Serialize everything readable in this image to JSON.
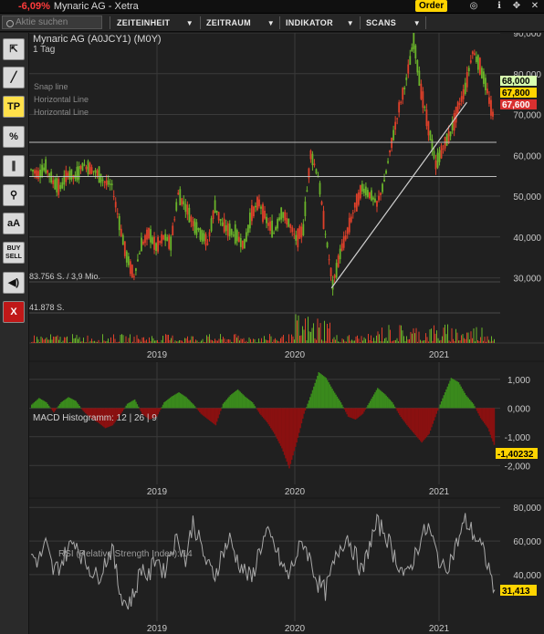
{
  "titlebar": {
    "change": "-6,09%",
    "title": "Mynaric AG - Xetra",
    "order_label": "Order"
  },
  "menubar": {
    "search_placeholder": "Aktie suchen",
    "items": [
      {
        "label": "ZEITEINHEIT"
      },
      {
        "label": "ZEITRAUM"
      },
      {
        "label": "INDIKATOR"
      },
      {
        "label": "SCANS"
      }
    ]
  },
  "toolbar": {
    "tools": [
      {
        "name": "cursor-tool",
        "label": "⇱"
      },
      {
        "name": "line-tool",
        "label": "╱"
      },
      {
        "name": "tp-tool",
        "label": "TP"
      },
      {
        "name": "percent-tool",
        "label": "%"
      },
      {
        "name": "parallel-tool",
        "label": "∥"
      },
      {
        "name": "zoom-tool",
        "label": "⚲"
      },
      {
        "name": "text-tool",
        "label": "aA"
      },
      {
        "name": "buy-sell-tool",
        "label": "BUY SELL"
      },
      {
        "name": "sound-tool",
        "label": "◀)"
      },
      {
        "name": "delete-tool",
        "label": "X"
      }
    ]
  },
  "colors": {
    "up": "#6ab42a",
    "down": "#e0402a",
    "macd_pos": "#3a8a1c",
    "macd_neg": "#8a1010",
    "grid": "#3a3a3a",
    "price_now": "#ffd400",
    "ask": "#d8ffb0",
    "bid": "#ff5050"
  },
  "main_chart": {
    "title": "Mynaric AG (A0JCY1) (M0Y)",
    "interval": "1 Tag",
    "annotations": [
      "Snap line",
      "Horizontal Line",
      "Horizontal Line"
    ],
    "volume_label_1": "83.756 S. / 3,9 Mio.",
    "volume_label_2": "41.878 S.",
    "price_tags": {
      "top": "68,000",
      "mid": "67,800",
      "bottom": "67,600"
    }
  },
  "macd_pane": {
    "label": "MACD Histogramm: 12 | 26 | 9",
    "value_tag": "-1,40232"
  },
  "rsi_pane": {
    "label": "RSI (Relative Strength Index): 14",
    "value_tag": "31,413"
  },
  "chart_data": [
    {
      "type": "line",
      "title": "Mynaric AG (A0JCY1) (M0Y)",
      "xlabel": "",
      "ylabel": "",
      "x_ticks": [
        "2019",
        "2020",
        "2021"
      ],
      "y_ticks": [
        30000,
        40000,
        50000,
        60000,
        70000,
        80000,
        90000
      ],
      "y_tick_labels": [
        "30,000",
        "40,000",
        "50,000",
        "60,000",
        "70,000",
        "80,000",
        "90,000"
      ],
      "ylim": [
        27000,
        90000
      ],
      "series": [
        {
          "values": [
            56500,
            55500,
            57000,
            53500,
            52000,
            55500,
            54500,
            57500,
            57000,
            55500,
            53500,
            52500,
            43500,
            35000,
            30500,
            38000,
            41000,
            37500,
            40000,
            38500,
            50500,
            47500,
            43500,
            41000,
            38500,
            47500,
            43000,
            41500,
            40000,
            38000,
            46000,
            48500,
            44000,
            41000,
            46000,
            43500,
            39500,
            42000,
            60500,
            55000,
            41000,
            28000,
            36000,
            41500,
            47500,
            52000,
            50500,
            48000,
            53500,
            63000,
            71500,
            78500,
            88000,
            76000,
            67000,
            57500,
            62000,
            65500,
            71500,
            76500,
            85500,
            82000,
            75500,
            68000
          ]
        }
      ],
      "horizontal_lines": [
        63200,
        54800
      ],
      "trend_line": {
        "from": [
          0.648,
          27500
        ],
        "to": [
          0.94,
          73000
        ]
      }
    },
    {
      "type": "bar",
      "title": "MACD Histogramm: 12 | 26 | 9",
      "y_ticks": [
        -2000,
        -1000,
        0,
        1000
      ],
      "y_tick_labels": [
        "-2,000",
        "-1,000",
        "0,000",
        "1,000"
      ],
      "ylim": [
        -2500,
        1600
      ],
      "values": [
        120,
        350,
        200,
        -150,
        200,
        380,
        250,
        -100,
        -350,
        -500,
        -700,
        -600,
        -250,
        150,
        300,
        -200,
        -400,
        -300,
        200,
        400,
        550,
        380,
        120,
        -200,
        -400,
        -600,
        150,
        450,
        650,
        400,
        200,
        -200,
        -500,
        -900,
        -1400,
        -2100,
        -1200,
        -200,
        500,
        1250,
        1050,
        600,
        200,
        -300,
        -400,
        -200,
        250,
        700,
        480,
        200,
        -250,
        -600,
        -900,
        -1200,
        -900,
        -200,
        450,
        1050,
        900,
        450,
        150,
        -350,
        -700,
        -1400
      ]
    },
    {
      "type": "line",
      "title": "RSI (Relative Strength Index): 14",
      "y_ticks": [
        40,
        60,
        80
      ],
      "y_tick_labels": [
        "40,000",
        "60,000",
        "80,000"
      ],
      "ylim": [
        15,
        85
      ],
      "series": [
        {
          "values": [
            52,
            48,
            58,
            42,
            46,
            55,
            61,
            50,
            44,
            38,
            47,
            56,
            31,
            22,
            28,
            45,
            38,
            52,
            41,
            55,
            62,
            48,
            72,
            58,
            45,
            40,
            53,
            61,
            49,
            42,
            37,
            55,
            64,
            58,
            46,
            39,
            51,
            60,
            48,
            35,
            30,
            44,
            57,
            63,
            52,
            41,
            58,
            70,
            66,
            55,
            46,
            38,
            50,
            62,
            68,
            54,
            43,
            49,
            60,
            72,
            65,
            58,
            47,
            31
          ]
        }
      ]
    }
  ]
}
